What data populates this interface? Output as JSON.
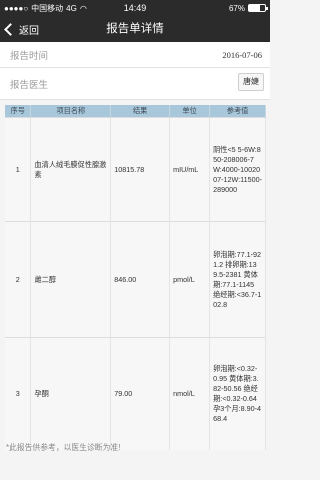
{
  "status_bar": {
    "carrier": "中国移动",
    "network": "4G",
    "time": "14:49",
    "battery_percent": "67%",
    "battery_level": 0.67
  },
  "nav": {
    "back_label": "返回",
    "title": "报告单详情"
  },
  "report_time": {
    "label": "报告时间",
    "value": "2016-07-06"
  },
  "report_doctor": {
    "label": "报告医生",
    "value": "唐婕"
  },
  "table": {
    "headers": [
      "序号",
      "项目名称",
      "结果",
      "单位",
      "参考值"
    ],
    "rows": [
      {
        "no": "1",
        "name": "血清人绒毛膜促性腺激素",
        "result": "10815.78",
        "unit": "mIU/mL",
        "reference": "阴性<5 5-6W:850-208006-7W:4000-1002007-12W:11500-289000"
      },
      {
        "no": "2",
        "name": "雌二醇",
        "result": "846.00",
        "unit": "pmol/L",
        "reference": "卵泡期:77.1-921.2 排卵期:139.5-2381 黄体期:77.1-1145 绝经期:<36.7-102.8"
      },
      {
        "no": "3",
        "name": "孕酮",
        "result": "79.00",
        "unit": "nmol/L",
        "reference": "卵泡期:<0.32-0.95 黄体期:3.82-50.56 绝经期:<0.32-0.64孕3个月:8.90-468.4"
      }
    ]
  },
  "footer": {
    "note": "*此报告供参考，以医生诊断为准!"
  }
}
